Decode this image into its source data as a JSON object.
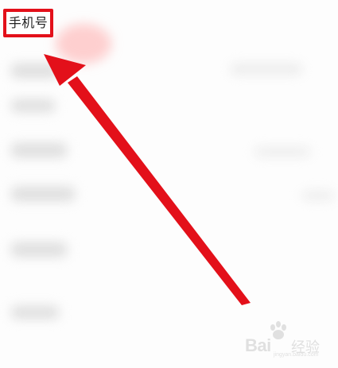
{
  "form": {
    "highlighted_field_label": "手机号"
  },
  "annotation": {
    "color": "#e3101a",
    "type": "arrow-to-box"
  },
  "watermark": {
    "brand": "Bai",
    "brand_suffix": "经验",
    "url": "jingyan.baidu.com"
  }
}
